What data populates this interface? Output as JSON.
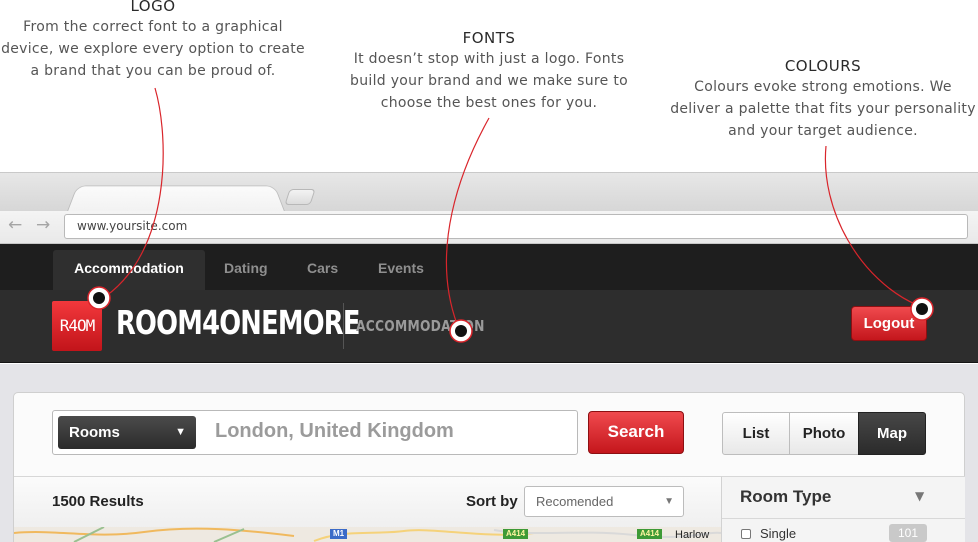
{
  "callouts": {
    "logo": {
      "title": "LOGO",
      "text": "From the correct font to a graphical device, we explore every option to create a brand that you can be proud of."
    },
    "fonts": {
      "title": "FONTS",
      "text": "It doesn’t stop with just a logo. Fonts build your brand and we make sure to choose the best ones for you."
    },
    "colours": {
      "title": "COLOURS",
      "text": "Colours evoke strong emotions. We deliver a palette that fits your personality and your target audience."
    }
  },
  "browser": {
    "url": "www.yoursite.com",
    "back_icon": "back-arrow-icon",
    "forward_icon": "forward-arrow-icon"
  },
  "site": {
    "nav": [
      {
        "label": "Accommodation",
        "active": true
      },
      {
        "label": "Dating",
        "active": false
      },
      {
        "label": "Cars",
        "active": false
      },
      {
        "label": "Events",
        "active": false
      }
    ],
    "logo_mark": "R4OM",
    "brand_name": "ROOM4ONEMORE",
    "section_name": "ACCOMMODATION",
    "logout_label": "Logout"
  },
  "search": {
    "category": "Rooms",
    "query": "London, United Kingdom",
    "button_label": "Search"
  },
  "views": {
    "list": "List",
    "photo": "Photo",
    "map": "Map",
    "selected": "Map"
  },
  "results": {
    "count_label": "1500 Results",
    "sort_label": "Sort by",
    "sort_value": "Recomended"
  },
  "map": {
    "badges": [
      "M1",
      "A414",
      "A414"
    ],
    "town": "Harlow"
  },
  "filters": {
    "title": "Room Type",
    "options": [
      {
        "label": "Single",
        "count": "101"
      }
    ]
  },
  "colors": {
    "accent_red": "#d9252b",
    "header_dark": "#2d2d2d",
    "leader_red": "#d9252b"
  }
}
